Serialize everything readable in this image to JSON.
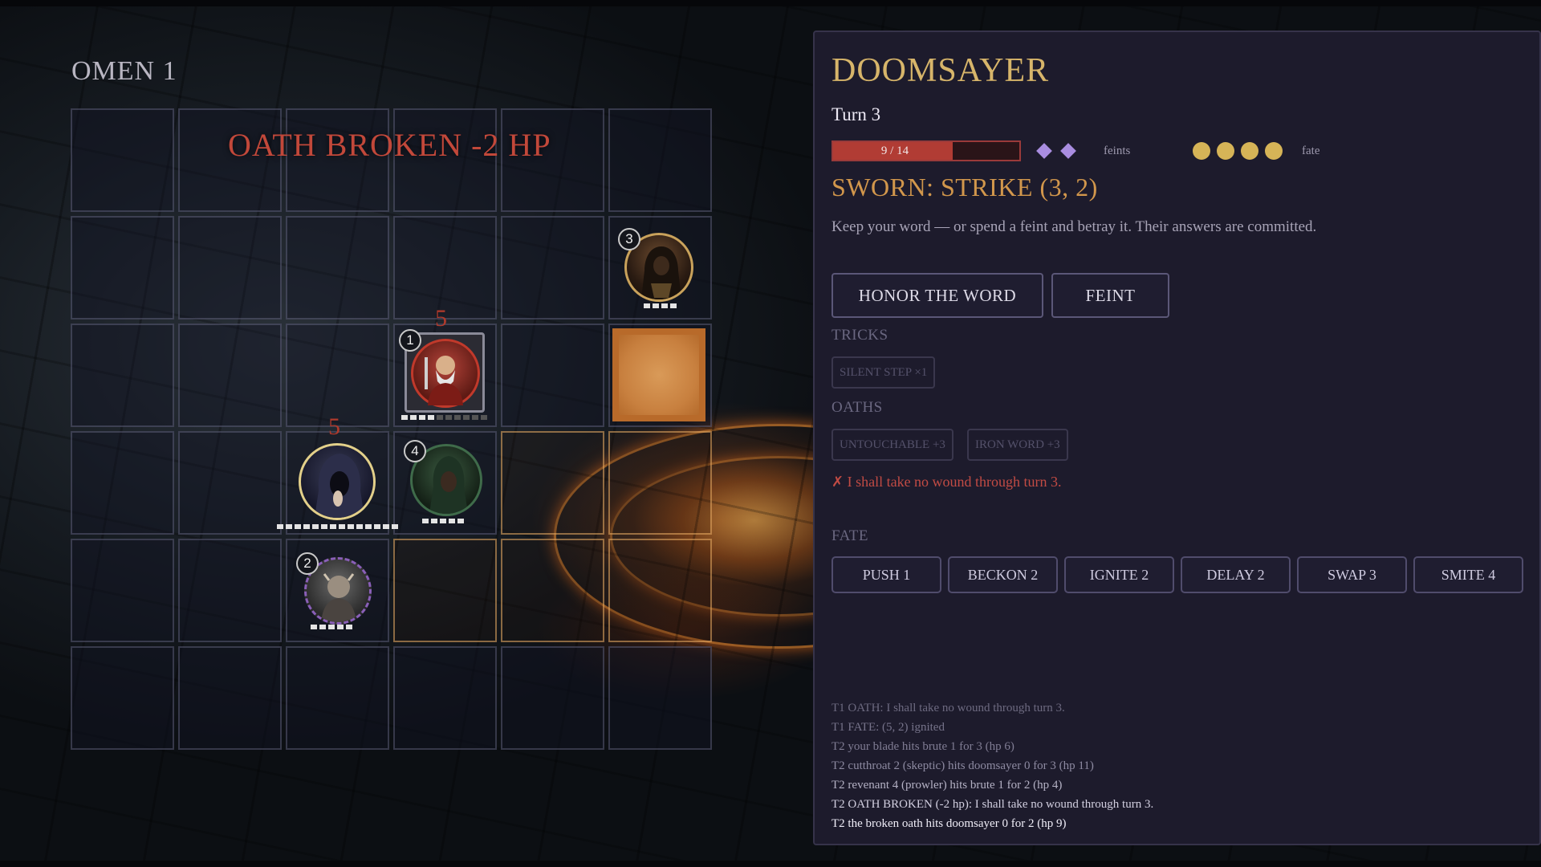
{
  "omen_title": "OMEN 1",
  "banner": "OATH BROKEN  -2 HP",
  "board": {
    "units": [
      {
        "badge": "1",
        "damage": "5"
      },
      {
        "badge": "2",
        "damage": ""
      },
      {
        "badge": "3",
        "damage": ""
      },
      {
        "badge": "4",
        "damage": ""
      },
      {
        "badge": "",
        "damage": "5"
      }
    ]
  },
  "panel": {
    "title": "DOOMSAYER",
    "turn": "Turn 3",
    "hp": {
      "current": 9,
      "max": 14,
      "label": "9 / 14",
      "color": "#b13c34"
    },
    "feints": {
      "count": 2,
      "label": "feints"
    },
    "fate": {
      "count": 4,
      "label": "fate"
    },
    "sworn": "SWORN: STRIKE (3, 2)",
    "hint": "Keep your word — or spend a feint and betray it. Their answers are committed.",
    "actions": {
      "honor": "HONOR THE WORD",
      "feint": "FEINT"
    },
    "tricks_header": "TRICKS",
    "tricks": [
      "SILENT STEP ×1"
    ],
    "oaths_header": "OATHS",
    "oaths": [
      "UNTOUCHABLE +3",
      "IRON WORD +3"
    ],
    "broken_oath": "✗ I shall take no wound through turn 3.",
    "fate_header": "FATE",
    "fate_actions": [
      "PUSH 1",
      "BECKON 2",
      "IGNITE 2",
      "DELAY 2",
      "SWAP 3",
      "SMITE 4"
    ],
    "log": [
      "T1 OATH: I shall take no wound through turn 3.",
      "T1 FATE: (5, 2) ignited",
      "T2 your blade hits brute 1 for 3 (hp 6)",
      "T2 cutthroat 2 (skeptic) hits doomsayer 0 for 3 (hp 11)",
      "T2 revenant 4 (prowler) hits brute 1 for 2 (hp 4)",
      "T2 OATH BROKEN (-2 hp): I shall take no wound through turn 3.",
      "T2 the broken oath hits doomsayer 0 for 2 (hp 9)"
    ]
  }
}
